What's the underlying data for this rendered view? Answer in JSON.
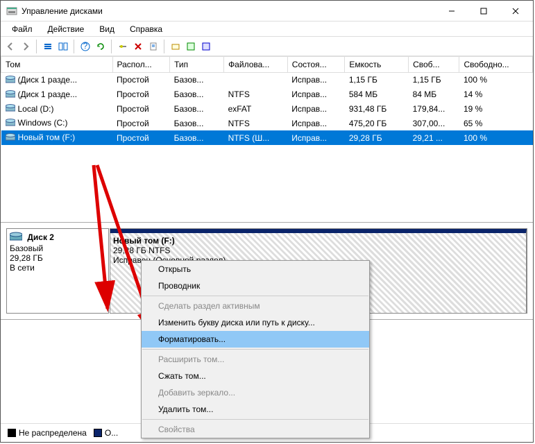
{
  "window": {
    "title": "Управление дисками"
  },
  "menu": {
    "file": "Файл",
    "action": "Действие",
    "view": "Вид",
    "help": "Справка"
  },
  "columns": {
    "volume": "Том",
    "layout": "Распол...",
    "type": "Тип",
    "filesystem": "Файлова...",
    "status": "Состоя...",
    "capacity": "Емкость",
    "free": "Своб...",
    "freepct": "Свободно..."
  },
  "rows": [
    {
      "vol": "(Диск 1 разде...",
      "layout": "Простой",
      "type": "Базов...",
      "fs": "",
      "status": "Исправ...",
      "cap": "1,15 ГБ",
      "free": "1,15 ГБ",
      "pct": "100 %"
    },
    {
      "vol": "(Диск 1 разде...",
      "layout": "Простой",
      "type": "Базов...",
      "fs": "NTFS",
      "status": "Исправ...",
      "cap": "584 МБ",
      "free": "84 МБ",
      "pct": "14 %"
    },
    {
      "vol": "Local (D:)",
      "layout": "Простой",
      "type": "Базов...",
      "fs": "exFAT",
      "status": "Исправ...",
      "cap": "931,48 ГБ",
      "free": "179,84...",
      "pct": "19 %"
    },
    {
      "vol": "Windows (C:)",
      "layout": "Простой",
      "type": "Базов...",
      "fs": "NTFS",
      "status": "Исправ...",
      "cap": "475,20 ГБ",
      "free": "307,00...",
      "pct": "65 %"
    },
    {
      "vol": "Новый том (F:)",
      "layout": "Простой",
      "type": "Базов...",
      "fs": "NTFS (Ш...",
      "status": "Исправ...",
      "cap": "29,28 ГБ",
      "free": "29,21 ...",
      "pct": "100 %",
      "selected": true
    }
  ],
  "disk": {
    "name": "Диск 2",
    "type": "Базовый",
    "size": "29,28 ГБ",
    "status": "В сети",
    "partition": {
      "title": "Новый том (F:)",
      "size": "29,28 ГБ NTFS",
      "status": "Исправен (Основной раздел)"
    }
  },
  "legend": {
    "unallocated": "Не распределена",
    "primary": "О..."
  },
  "context": {
    "open": "Открыть",
    "explorer": "Проводник",
    "active": "Сделать раздел активным",
    "change_letter": "Изменить букву диска или путь к диску...",
    "format": "Форматировать...",
    "extend": "Расширить том...",
    "shrink": "Сжать том...",
    "mirror": "Добавить зеркало...",
    "delete": "Удалить том...",
    "properties": "Свойства"
  }
}
